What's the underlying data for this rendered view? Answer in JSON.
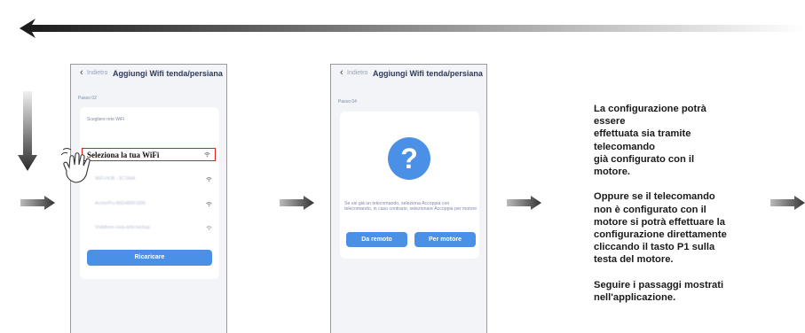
{
  "phone1": {
    "back_label": "Indietro",
    "title": "Aggiungi Wifi tenda/persiana",
    "step": "Passo 02",
    "choose_label": "Scegliere rete WiFi",
    "selected_network": "Seleziona la tua WiFi",
    "networks": [
      "WiFi-HUB - 3C7A4A",
      "ArcherPro-B6D4B6F0395",
      "Vodafone-casa-adsl-backup"
    ],
    "reload_button": "Ricaricare"
  },
  "phone2": {
    "back_label": "Indietro",
    "title": "Aggiungi Wifi tenda/persiana",
    "step": "Passo 04",
    "question_glyph": "?",
    "help_text": "Se usi già un telecomando, seleziona Accoppia con telecomando, in caso contrario, selezionare Accoppia per motore",
    "remote_button": "Da remoto",
    "motor_button": "Per motore"
  },
  "description": {
    "lines": [
      "La configurazione potrà",
      "essere",
      "effettuata sia tramite",
      "telecomando",
      "già configurato con il",
      "motore.",
      "",
      "Oppure se il telecomando",
      "non è configurato con il",
      "motore si potrà effettuare la",
      "configurazione direttamente",
      "cliccando il tasto P1 sulla",
      "testa del motore.",
      "",
      "Seguire i passaggi mostrati",
      "nell'applicazione."
    ]
  },
  "colors": {
    "accent_blue": "#4a90e6",
    "highlight_red": "#e02020",
    "arrow_dark": "#2b2b2b"
  }
}
